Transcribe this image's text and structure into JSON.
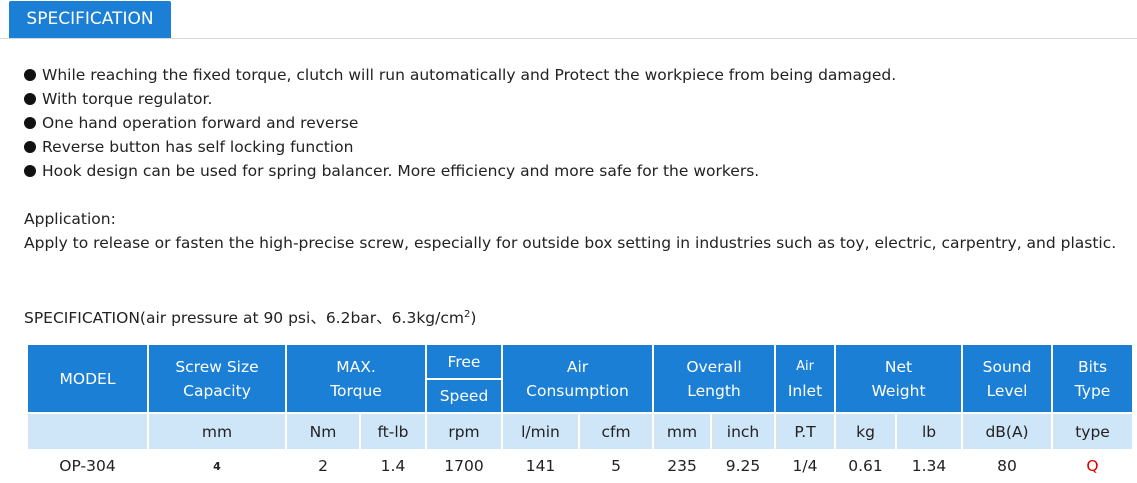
{
  "tab": {
    "label": "SPECIFICATION"
  },
  "features": [
    "While reaching the fixed torque, clutch will run automatically and Protect the workpiece from being damaged.",
    "With torque regulator.",
    "One hand operation forward and reverse",
    "Reverse button has self locking function",
    "Hook design can be used for spring balancer. More efficiency and more safe for the workers."
  ],
  "application": {
    "heading": "Application:",
    "text": "Apply to release or fasten the high-precise screw, especially for outside box setting in industries such as toy, electric, carpentry, and plastic."
  },
  "spec_heading": {
    "text": "SPECIFICATION(air pressure at 90 psi、6.2bar、6.3kg/cm",
    "superscript": "2",
    "close": ")"
  },
  "table": {
    "headers": {
      "model": "MODEL",
      "screw_size": [
        "Screw Size",
        "Capacity"
      ],
      "max_torque": [
        "MAX.",
        "Torque"
      ],
      "free_speed": [
        "Free",
        "Speed"
      ],
      "air_consumption": [
        "Air",
        "Consumption"
      ],
      "overall_length": [
        "Overall",
        "Length"
      ],
      "air_inlet": [
        "Air",
        "Inlet"
      ],
      "net_weight": [
        "Net",
        "Weight"
      ],
      "sound_level": [
        "Sound",
        "Level"
      ],
      "bits_type": [
        "Bits",
        "Type"
      ]
    },
    "units": [
      "mm",
      "Nm",
      "ft-lb",
      "rpm",
      "l/min",
      "cfm",
      "mm",
      "inch",
      "P.T",
      "kg",
      "lb",
      "dB(A)",
      "type"
    ],
    "rows": [
      {
        "model": "OP-304",
        "values": [
          "4",
          "2",
          "1.4",
          "1700",
          "141",
          "5",
          "235",
          "9.25",
          "1/4",
          "0.61",
          "1.34",
          "80",
          "Q"
        ]
      }
    ]
  },
  "colors": {
    "accent": "#1b7fd6",
    "unit_row": "#cfe5f8",
    "bits_type_value": "#e00000"
  }
}
